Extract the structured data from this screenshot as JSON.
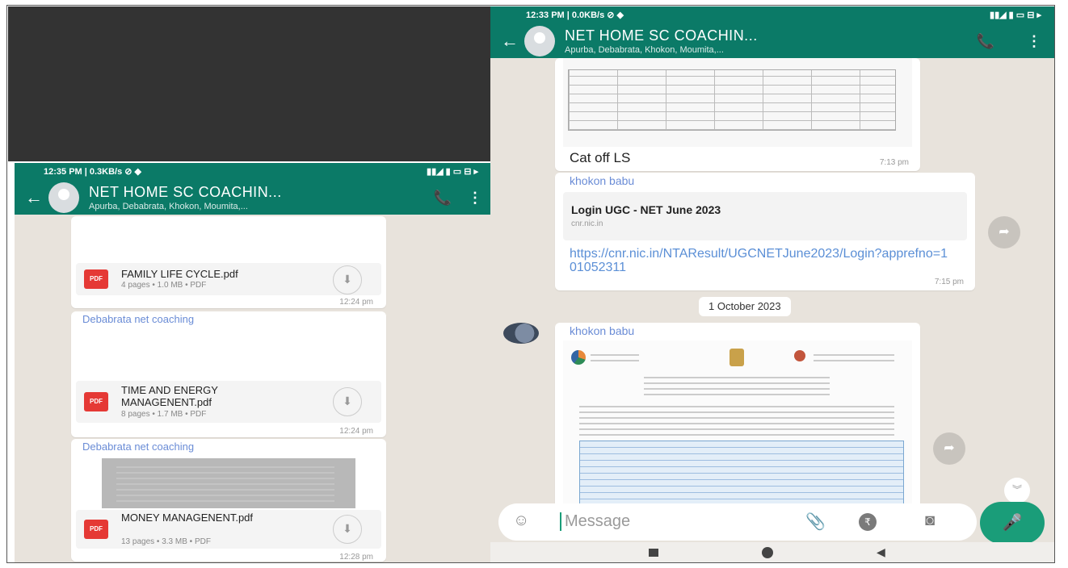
{
  "left_phone": {
    "status_time": "12:35 PM | 0.3KB/s ⊘ ◆",
    "status_icons": "▮▮◢ ▮ ▭ ⊟ ▸",
    "chat_title": "NET HOME SC COACHIN...",
    "chat_subtitle": "Apurba, Debabrata, Khokon, Moumita,...",
    "messages": [
      {
        "filename": "FAMILY LIFE CYCLE.pdf",
        "meta": "4 pages • 1.0 MB • PDF",
        "time": "12:24 pm"
      },
      {
        "sender": "Debabrata net coaching",
        "filename": "TIME AND ENERGY MANAGENENT.pdf",
        "meta": "8 pages • 1.7 MB • PDF",
        "time": "12:24 pm"
      },
      {
        "sender": "Debabrata net coaching",
        "filename": "MONEY MANAGENENT.pdf",
        "meta": "13 pages • 3.3 MB • PDF",
        "time": "12:28 pm"
      }
    ],
    "pdf_badge": "PDF"
  },
  "right_phone": {
    "status_time": "12:33 PM | 0.0KB/s ⊘ ◆",
    "status_icons": "▮▮◢ ▮ ▭ ⊟ ▸",
    "chat_title": "NET HOME SC COACHIN...",
    "chat_subtitle": "Apurba, Debabrata, Khokon, Moumita,...",
    "image_caption": "Cat off LS",
    "image_time": "7:13 pm",
    "link_message": {
      "sender": "khokon babu",
      "preview_title": "Login UGC - NET June 2023",
      "preview_domain": "cnr.nic.in",
      "url": "https://cnr.nic.in/NTAResult/UGCNETJune2023/Login?apprefno=101052311",
      "time": "7:15 pm"
    },
    "date_chip": "1 October 2023",
    "doc_message": {
      "sender": "khokon babu"
    },
    "input_placeholder": "Message"
  },
  "colors": {
    "header": "#0b7a67",
    "chat_bg": "#e8e3dc",
    "mic": "#1a9d79",
    "sender": "#6a8cd6",
    "pdf": "#e53935"
  }
}
